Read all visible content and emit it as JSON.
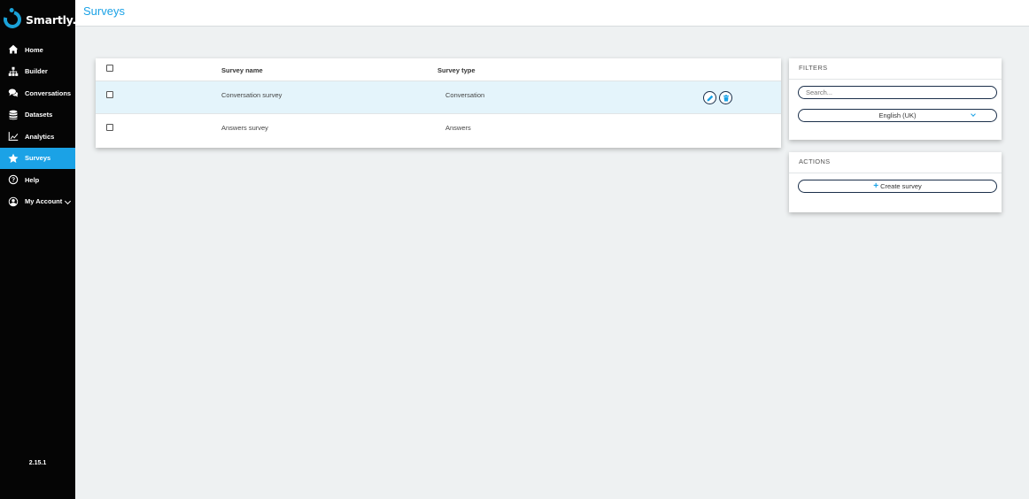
{
  "brand": {
    "name": "Smartly.ai",
    "accent": "#1ba2e6",
    "nav_bg": "#050505"
  },
  "sidebar": {
    "items": [
      {
        "label": "Home",
        "icon": "home-icon",
        "active": false
      },
      {
        "label": "Builder",
        "icon": "sitemap-icon",
        "active": false
      },
      {
        "label": "Conversations",
        "icon": "comments-icon",
        "active": false
      },
      {
        "label": "Datasets",
        "icon": "database-icon",
        "active": false
      },
      {
        "label": "Analytics",
        "icon": "chart-line-icon",
        "active": false
      },
      {
        "label": "Surveys",
        "icon": "star-icon",
        "active": true
      },
      {
        "label": "Help",
        "icon": "question-circle-icon",
        "active": false
      },
      {
        "label": "My Account",
        "icon": "user-circle-icon",
        "active": false
      }
    ],
    "version": "2.15.1"
  },
  "header": {
    "title": "Surveys"
  },
  "table": {
    "columns": [
      "Survey name",
      "Survey type"
    ],
    "rows": [
      {
        "name": "Conversation survey",
        "type": "Conversation",
        "selected": true
      },
      {
        "name": "Answers survey",
        "type": "Answers",
        "selected": false
      }
    ]
  },
  "filters": {
    "title": "FILTERS",
    "search_placeholder": "Search...",
    "language": "English (UK)"
  },
  "actions": {
    "title": "ACTIONS",
    "create_label": "Create survey"
  }
}
